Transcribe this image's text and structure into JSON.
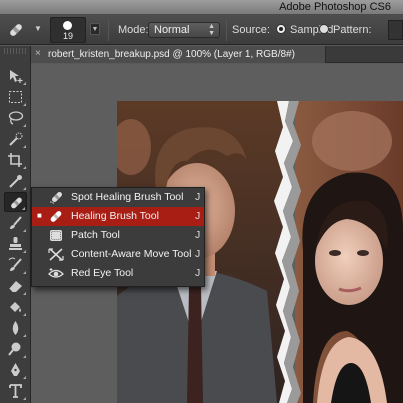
{
  "app": {
    "title": "Adobe Photoshop CS6"
  },
  "options_bar": {
    "brush_size": "19",
    "mode_label": "Mode:",
    "mode_value": "Normal",
    "source_label": "Source:",
    "source_sampled_label": "Sampled",
    "source_pattern_label": "Pattern:",
    "source_selected": "Sampled"
  },
  "document": {
    "close_glyph": "×",
    "tab_title": "robert_kristen_breakup.psd @ 100% (Layer 1, RGB/8#)"
  },
  "toolbar": {
    "active_tool": "healing-brush",
    "tools": [
      "move",
      "marquee",
      "lasso",
      "quick-selection",
      "crop",
      "eyedropper",
      "healing-brush",
      "brush",
      "clone-stamp",
      "history-brush",
      "eraser",
      "gradient",
      "blur",
      "dodge",
      "pen",
      "type"
    ]
  },
  "flyout": {
    "items": [
      {
        "label": "Spot Healing Brush Tool",
        "shortcut": "J",
        "icon": "spot-healing-brush-icon",
        "selected": false
      },
      {
        "label": "Healing Brush Tool",
        "shortcut": "J",
        "icon": "healing-brush-icon",
        "selected": true
      },
      {
        "label": "Patch Tool",
        "shortcut": "J",
        "icon": "patch-icon",
        "selected": false
      },
      {
        "label": "Content-Aware Move Tool",
        "shortcut": "J",
        "icon": "content-aware-move-icon",
        "selected": false
      },
      {
        "label": "Red Eye Tool",
        "shortcut": "J",
        "icon": "red-eye-icon",
        "selected": false
      }
    ],
    "selected_marker": "■"
  },
  "colors": {
    "selection_highlight": "#a81e15",
    "panel_bg": "#3c3c3c",
    "canvas_bg": "#5e5e5e"
  }
}
